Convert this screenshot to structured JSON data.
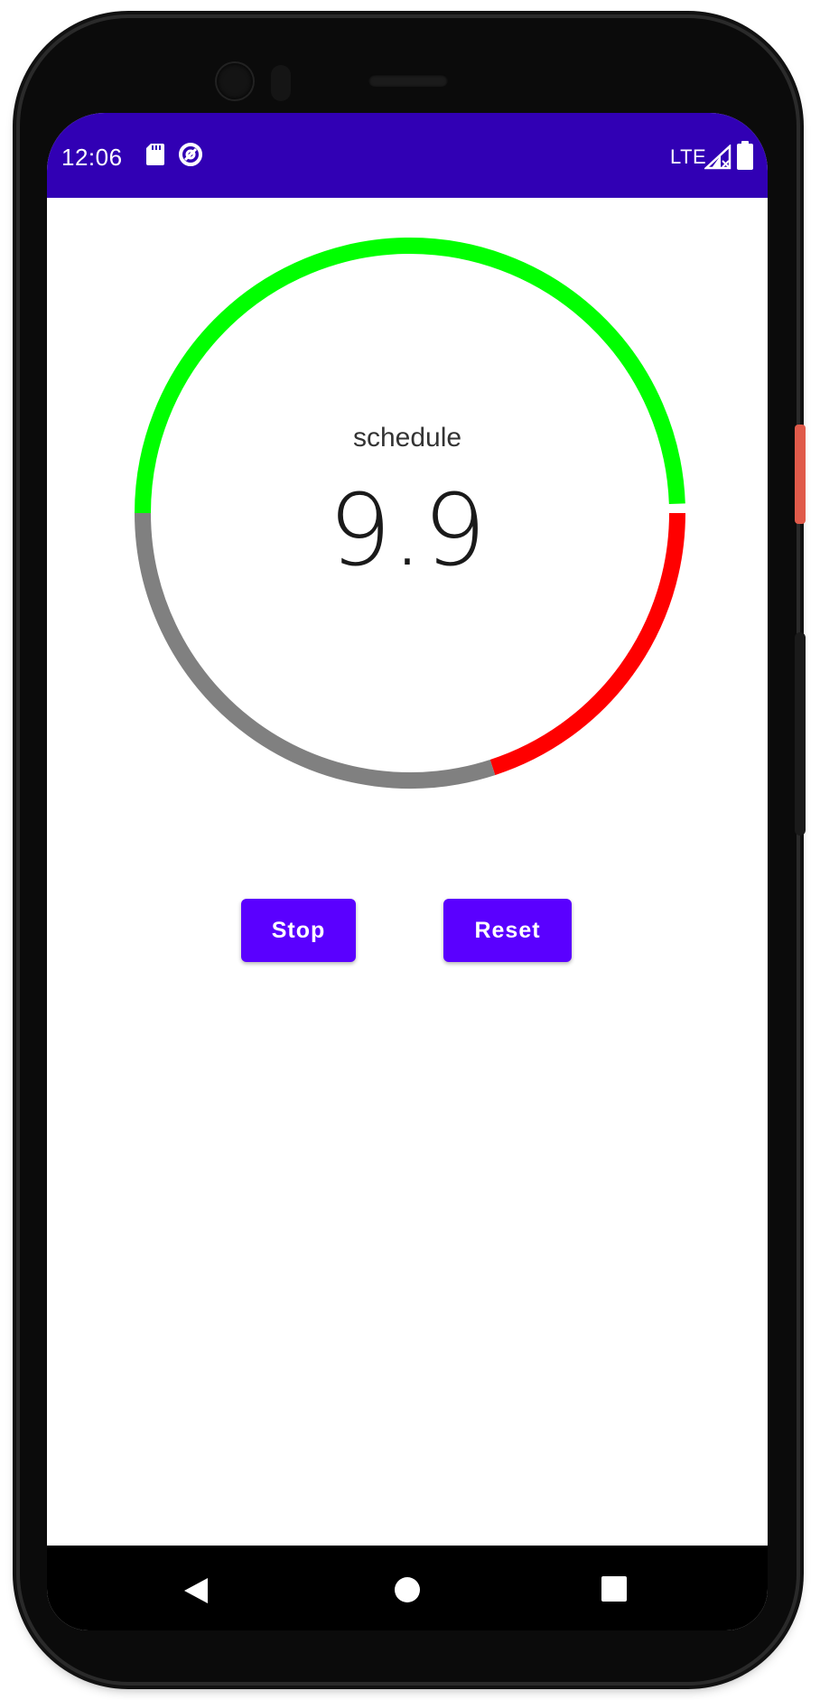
{
  "status_bar": {
    "time": "12:06",
    "network": "LTE",
    "background_color": "#3100b4"
  },
  "timer": {
    "label": "schedule",
    "value": "9.9",
    "ring_segments": [
      {
        "name": "elapsed",
        "color": "#00ff00",
        "fraction": 0.5
      },
      {
        "name": "warning",
        "color": "#ff0000",
        "fraction": 0.2
      },
      {
        "name": "remaining",
        "color": "#808080",
        "fraction": 0.3
      }
    ]
  },
  "buttons": {
    "stop_label": "Stop",
    "reset_label": "Reset",
    "color": "#5a00ff"
  },
  "nav_bar": {
    "back_icon": "back-triangle-icon",
    "home_icon": "home-circle-icon",
    "recents_icon": "recents-square-icon"
  }
}
